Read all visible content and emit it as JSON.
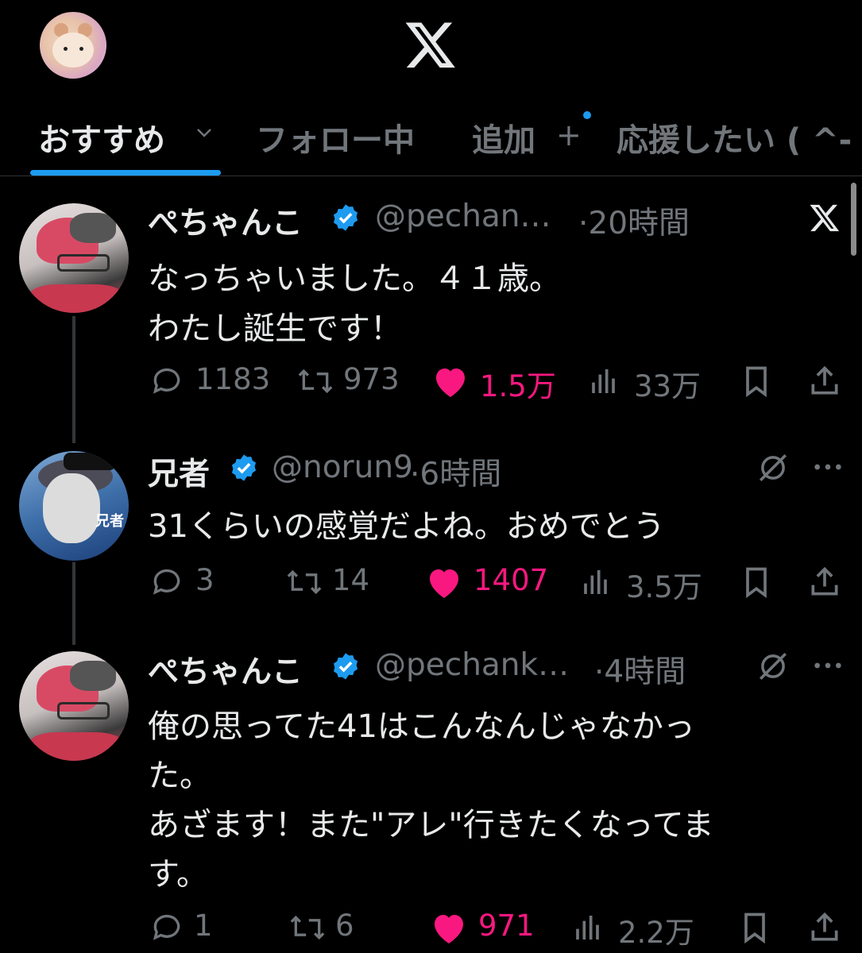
{
  "header": {
    "logo": "x-logo"
  },
  "tabs": [
    {
      "label": "おすすめ",
      "active": true
    },
    {
      "label": "フォロー中",
      "active": false
    },
    {
      "label": "追加",
      "active": false
    },
    {
      "label": "応援したい ( ^-",
      "active": false
    }
  ],
  "tab_plus": "+",
  "posts": [
    {
      "name": "ぺちゃんこ",
      "handle": "@pechan…",
      "time": "·20時間",
      "lines": [
        "なっちゃいました。４１歳。",
        "わたし誕生です！"
      ],
      "replies": "1183",
      "reposts": "973",
      "likes": "1.5万",
      "views": "33万"
    },
    {
      "name": "兄者",
      "handle": "@norun9",
      "time": "·6時間",
      "lines": [
        "31くらいの感覚だよね。おめでとう"
      ],
      "replies": "3",
      "reposts": "14",
      "likes": "1407",
      "views": "3.5万"
    },
    {
      "name": "ぺちゃんこ",
      "handle": "@pechank…",
      "time": "·4時間",
      "lines": [
        "俺の思ってた41はこんなんじゃなかっ",
        "た。",
        "あざます！また\"アレ\"行きたくなってま",
        "す。"
      ],
      "replies": "1",
      "reposts": "6",
      "likes": "971",
      "views": "2.2万"
    }
  ],
  "colors": {
    "accent": "#1d9bf0",
    "like": "#f91880",
    "muted": "#71767b",
    "text": "#e7e9ea"
  }
}
